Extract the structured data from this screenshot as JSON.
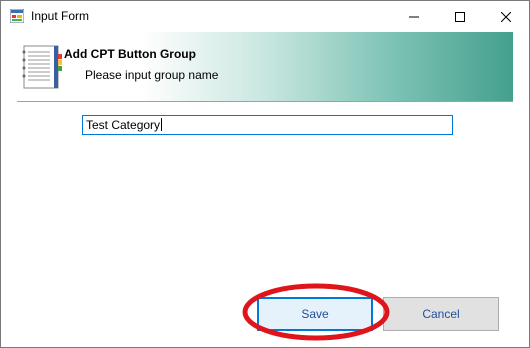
{
  "window": {
    "title": "Input Form",
    "controls": {
      "minimize": "minimize",
      "maximize": "maximize",
      "close": "close"
    }
  },
  "banner": {
    "title": "Add CPT Button Group",
    "subtitle": "Please input group name"
  },
  "form": {
    "group_name_value": "Test Category"
  },
  "buttons": {
    "save_label": "Save",
    "cancel_label": "Cancel"
  },
  "colors": {
    "focus_border": "#0078d7",
    "button_text": "#1f4f9a",
    "annotation_red": "#e0151c",
    "banner_gradient_end": "#44a08c"
  },
  "icons": {
    "app": "form-app-icon",
    "banner": "notebook-icon",
    "annotation": "red-ellipse-highlight"
  }
}
